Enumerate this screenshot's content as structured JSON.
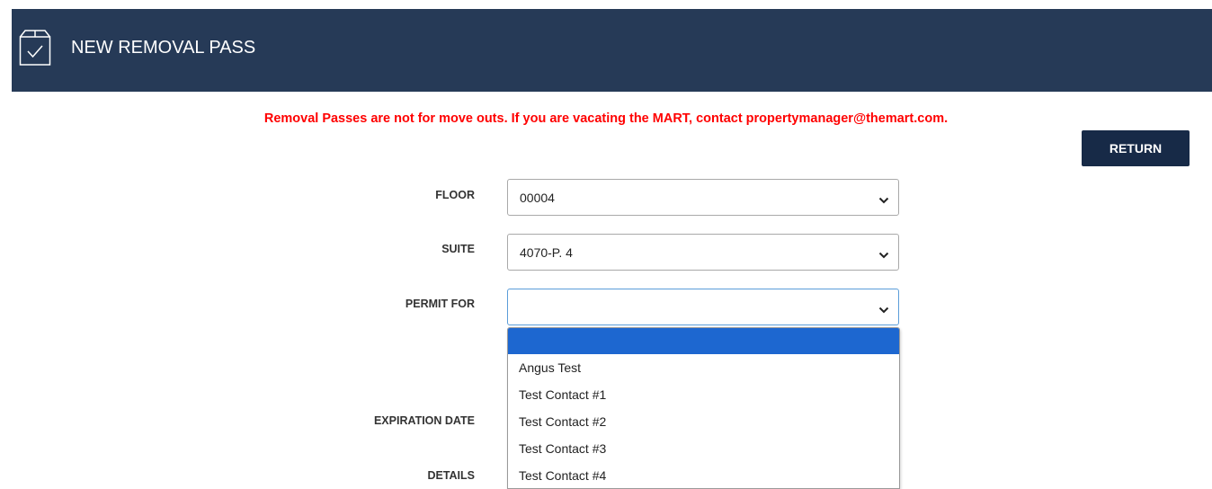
{
  "header": {
    "title": "NEW REMOVAL PASS",
    "icon": "package-check-icon",
    "background": "#263a57"
  },
  "warning": {
    "text": "Removal Passes are not for move outs. If you are vacating the MART, contact propertymanager@themart.com.",
    "color": "#ff0000"
  },
  "return_button": {
    "label": "RETURN",
    "background": "#172a47"
  },
  "form": {
    "floor": {
      "label": "FLOOR",
      "value": "00004"
    },
    "suite": {
      "label": "SUITE",
      "value": "4070-P. 4"
    },
    "permit_for": {
      "label": "PERMIT FOR",
      "value": ""
    },
    "expiration_date": {
      "label": "EXPIRATION DATE"
    },
    "details": {
      "label": "DETAILS"
    }
  },
  "permit_dropdown": {
    "options": [
      "",
      "Angus Test",
      "Test Contact #1",
      "Test Contact #2",
      "Test Contact #3",
      "Test Contact #4"
    ],
    "highlighted_index": 0,
    "highlight_color": "#1d67d0"
  }
}
